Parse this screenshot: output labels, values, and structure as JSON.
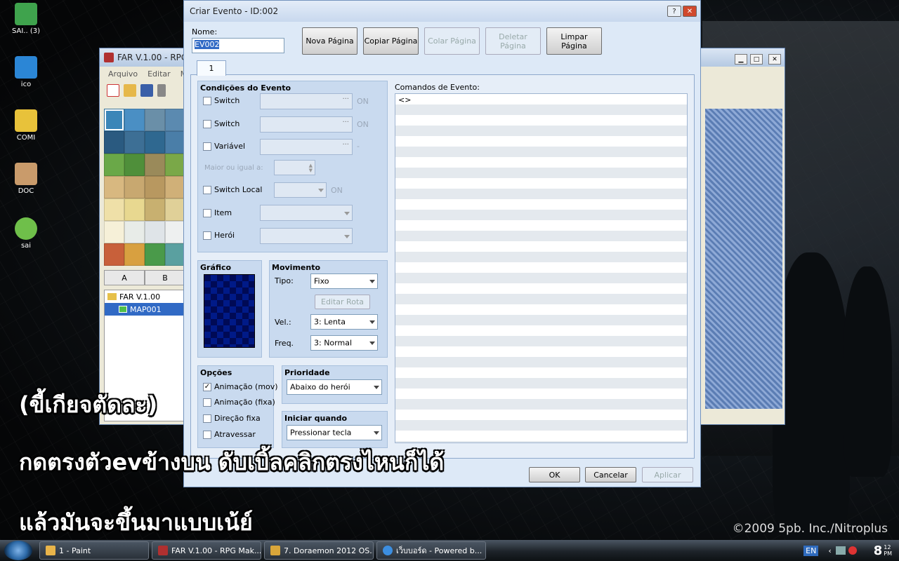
{
  "desktop": {
    "icons": [
      {
        "label": "SAI.. (3)",
        "color": "#3fa34d"
      },
      {
        "label": "ico",
        "color": "#2b86d6"
      },
      {
        "label": "COMI",
        "color": "#e8c23a"
      },
      {
        "label": "DOC",
        "color": "#c99b6b"
      },
      {
        "label": "sai",
        "color": "#6fbf4a"
      }
    ],
    "copyright": "©2009 5pb. Inc./Nitroplus"
  },
  "back_window": {
    "title": "FAR V.1.00 - RPG",
    "menu": [
      "Arquivo",
      "Editar",
      "M"
    ],
    "tabs": [
      "A",
      "B"
    ],
    "tree": [
      "FAR V.1.00",
      "MAP001"
    ]
  },
  "dialog": {
    "title": "Criar Evento - ID:002",
    "help": "?",
    "close": "✕",
    "name_label": "Nome:",
    "name_value": "EV002",
    "buttons": {
      "nova": "Nova Página",
      "copiar": "Copiar Página",
      "colar": "Colar Página",
      "deletar": "Deletar Página",
      "limpar": "Limpar Página"
    },
    "page_tab": "1",
    "conditions": {
      "title": "Condições do Evento",
      "switch1": "Switch",
      "switch2": "Switch",
      "variavel": "Variável",
      "on1": "ON",
      "on2": "ON",
      "dash": "-",
      "maior": "Maior ou igual a:",
      "switch_local": "Switch Local",
      "on3": "ON",
      "item": "Item",
      "heroi": "Herói",
      "ellipsis": "···"
    },
    "grafico": {
      "title": "Gráfico"
    },
    "movimento": {
      "title": "Movimento",
      "tipo_label": "Tipo:",
      "tipo": "Fixo",
      "editar": "Editar Rota",
      "vel_label": "Vel.:",
      "vel": "3: Lenta",
      "freq_label": "Freq.",
      "freq": "3: Normal"
    },
    "opcoes": {
      "title": "Opções",
      "anim_mov": "Animação (mov)",
      "anim_fixa": "Animação (fixa)",
      "direcao": "Direção fixa",
      "atravessar": "Atravessar"
    },
    "prioridade": {
      "title": "Prioridade",
      "value": "Abaixo do herói"
    },
    "iniciar": {
      "title": "Iniciar quando",
      "value": "Pressionar tecla"
    },
    "comandos": {
      "title": "Comandos de Evento:",
      "first": "<>"
    },
    "ok": "OK",
    "cancelar": "Cancelar",
    "aplicar": "Aplicar"
  },
  "overlay": [
    "(ขี้เกียจตัดละ)",
    "กดตรงตัวevข้างบน ดับเบิ้ลคลิกตรงไหนก็ได้",
    "แล้วมันจะขึ้นมาแบบเน้ย์"
  ],
  "taskbar": {
    "items": [
      {
        "label": "1 - Paint",
        "color": "#e8b44a"
      },
      {
        "label": "FAR V.1.00 - RPG Mak...",
        "color": "#b03030"
      },
      {
        "label": "7. Doraemon 2012 OS...",
        "color": "#d9a63a"
      },
      {
        "label": "เว็บบอร์ด - Powered b...",
        "color": "#3c8ee0"
      }
    ],
    "lang": "EN",
    "clock": "8",
    "clock_min": "12",
    "clock_ampm": "PM"
  }
}
